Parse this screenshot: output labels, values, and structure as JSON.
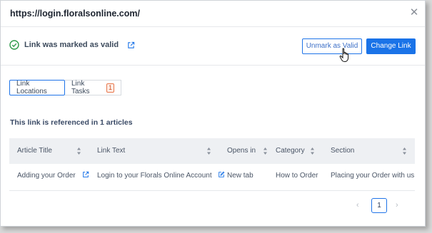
{
  "header": {
    "title": "https://login.floralsonline.com/"
  },
  "status": {
    "text": "Link was marked as valid"
  },
  "actions": {
    "unmark_label": "Unmark as Valid",
    "change_label": "Change Link"
  },
  "tabs": [
    {
      "label": "Link Locations",
      "active": true
    },
    {
      "label": "Link Tasks",
      "badge": "1",
      "active": false
    }
  ],
  "reference_text": "This link is referenced in 1 articles",
  "table": {
    "columns": [
      "Article Title",
      "Link Text",
      "Opens in",
      "Category",
      "Section"
    ],
    "rows": [
      [
        "Adding your Order",
        "Login to your Florals Online Account",
        "New tab",
        "How to Order",
        "Placing your Order with us"
      ]
    ]
  },
  "pagination": {
    "current": "1",
    "prev": "‹",
    "next": "›"
  },
  "colors": {
    "accent": "#1a73e8",
    "success": "#2e9a4a",
    "badge": "#e8774c"
  }
}
